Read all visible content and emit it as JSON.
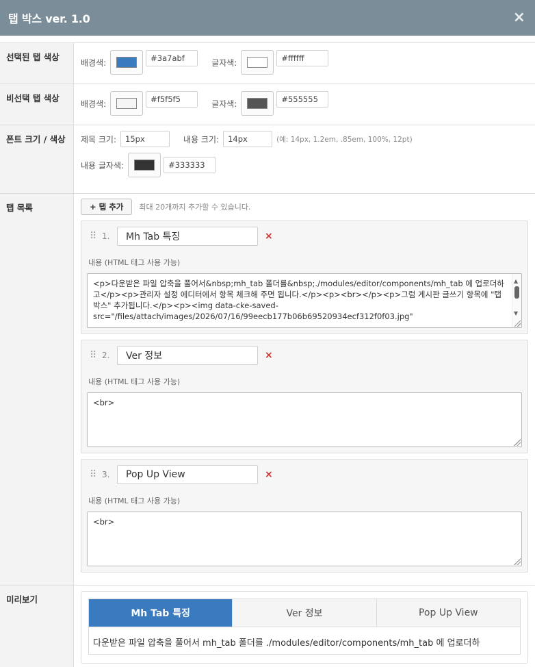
{
  "window": {
    "title": "탭 박스 ver. 1.0",
    "close": "×"
  },
  "selected_tab_color": {
    "label": "선택된 탭 색상",
    "bg_label": "배경색:",
    "bg_value": "#3a7abf",
    "bg_color": "#3a7abf",
    "fg_label": "글자색:",
    "fg_value": "#ffffff",
    "fg_color": "#ffffff"
  },
  "unselected_tab_color": {
    "label": "비선택 탭 색상",
    "bg_label": "배경색:",
    "bg_value": "#f5f5f5",
    "bg_color": "#f5f5f5",
    "fg_label": "글자색:",
    "fg_value": "#555555",
    "fg_color": "#555555"
  },
  "font": {
    "label": "폰트 크기 / 색상",
    "title_size_label": "제목 크기:",
    "title_size_value": "15px",
    "content_size_label": "내용 크기:",
    "content_size_value": "14px",
    "hint": "(예: 14px, 1.2em, .85em, 100%, 12pt)",
    "content_color_label": "내용 글자색:",
    "content_color_value": "#333333",
    "content_color": "#333333"
  },
  "tab_list": {
    "label": "탭 목록",
    "add_button": "+ 탭 추가",
    "add_hint": "최대 20개까지 추가할 수 있습니다.",
    "drag_icon": "⠿",
    "delete_icon": "×",
    "content_label": "내용 (HTML 태그 사용 가능)",
    "tabs": [
      {
        "num": "1.",
        "title": "Mh Tab 특징",
        "content": "<p>다운받은 파일 압축을 풀어서&nbsp;mh_tab 폴더를&nbsp;./modules/editor/components/mh_tab 에 업로더하고</p><p>관리자 설정 에디터에서 항목 체크해 주면 됩니다.</p><p><br></p><p>그럼 게시판 글쓰기 항목에 \"탭 박스\" 추가됩니다.</p><p><img data-cke-saved-src=\"/files/attach/images/2026/07/16/99eecb177b06b69520934ecf312f0f03.jpg\""
      },
      {
        "num": "2.",
        "title": "Ver 정보",
        "content": "<br>"
      },
      {
        "num": "3.",
        "title": "Pop Up View",
        "content": "<br>"
      }
    ]
  },
  "preview": {
    "label": "미리보기",
    "tabs": [
      "Mh Tab 특징",
      "Ver 정보",
      "Pop Up View"
    ],
    "content": "다운받은 파일 압축을 풀어서 mh_tab 폴더를 ./modules/editor/components/mh_tab 에 업로더하"
  }
}
